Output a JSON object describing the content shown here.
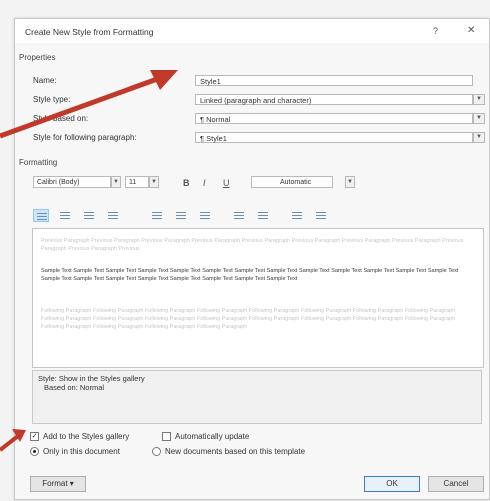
{
  "dialog": {
    "title": "Create New Style from Formatting",
    "help": "?",
    "close": "✕"
  },
  "properties": {
    "group_label": "Properties",
    "name_label": "Name:",
    "name_value": "Style1",
    "style_type_label": "Style type:",
    "style_type_value": "Linked (paragraph and character)",
    "based_on_label": "Style based on:",
    "based_on_value": "¶  Normal",
    "following_label": "Style for following paragraph:",
    "following_value": "¶  Style1"
  },
  "formatting": {
    "group_label": "Formatting",
    "font": "Calibri (Body)",
    "size": "11",
    "bold": "B",
    "italic": "I",
    "underline": "U",
    "color": "Automatic"
  },
  "preview": {
    "previous_text": "Previous Paragraph Previous Paragraph Previous Paragraph Previous Paragraph Previous Paragraph Previous Paragraph Previous Paragraph Previous Paragraph Previous Paragraph Previous Paragraph Previous",
    "sample_text": "Sample Text Sample Text Sample Text Sample Text Sample Text Sample Text Sample Text Sample Text Sample Text Sample Text Sample Text Sample Text Sample Text Sample Text Sample Text Sample Text Sample Text Sample Text Sample Text Sample Text Sample Text",
    "following_text": "Following Paragraph Following Paragraph Following Paragraph Following Paragraph Following Paragraph Following Paragraph Following Paragraph Following Paragraph Following Paragraph Following Paragraph Following Paragraph Following Paragraph Following Paragraph Following Paragraph Following Paragraph Following Paragraph Following Paragraph Following Paragraph Following Paragraph Following Paragraph"
  },
  "description": {
    "line1": "Style: Show in the Styles gallery",
    "line2": "Based on: Normal"
  },
  "options": {
    "add_gallery": "Add to the Styles gallery",
    "auto_update": "Automatically update",
    "only_doc": "Only in this document",
    "new_docs": "New documents based on this template"
  },
  "buttons": {
    "format": "Format ▾",
    "ok": "OK",
    "cancel": "Cancel"
  },
  "colors": {
    "arrow": "#c0392b"
  }
}
